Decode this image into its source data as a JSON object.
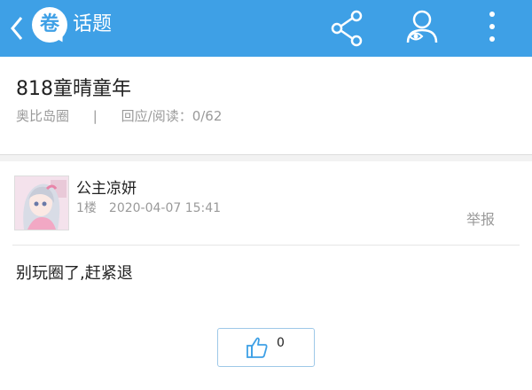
{
  "header": {
    "title": "话题",
    "logo_char": "卷",
    "icons": [
      "back-icon",
      "share-icon",
      "user-eye-icon",
      "more-vertical-icon"
    ],
    "background_color": "#3ea0e6"
  },
  "topic": {
    "title": "818童晴童年",
    "circle": "奥比岛圈",
    "separator": "|",
    "stats": "回应/阅读：0/62"
  },
  "post": {
    "author": "公主凉妍",
    "floor": "1楼",
    "time": "2020-04-07 15:41",
    "report": "举报",
    "content": "别玩圈了,赶紧退",
    "likes": "0"
  }
}
